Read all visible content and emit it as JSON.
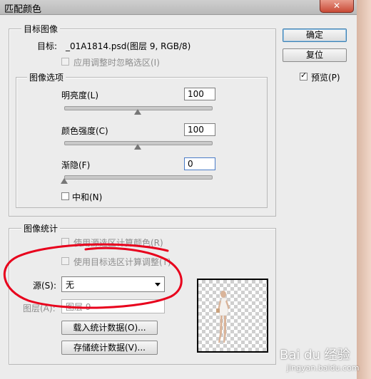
{
  "window": {
    "title": "匹配颜色",
    "close_symbol": "✕"
  },
  "target_image": {
    "group_label": "目标图像",
    "target_label": "目标:",
    "target_value": "_01A1814.psd(图层 9, RGB/8)",
    "ignore_selection_label": "应用调整时忽略选区(I)"
  },
  "image_options": {
    "group_label": "图像选项",
    "luminance_label": "明亮度(L)",
    "luminance_value": "100",
    "luminance_level": 0.5,
    "color_intensity_label": "颜色强度(C)",
    "color_intensity_value": "100",
    "color_intensity_level": 0.5,
    "fade_label": "渐隐(F)",
    "fade_value": "0",
    "fade_level": 0,
    "neutralize_label": "中和(N)"
  },
  "image_statistics": {
    "group_label": "图像统计",
    "use_source_selection_label": "使用源选区计算颜色(R)",
    "use_target_selection_label": "使用目标选区计算调整(T)",
    "source_label": "源(S):",
    "source_value": "无",
    "layer_label": "图层(A):",
    "layer_value": "图层 9",
    "load_stats_label": "载入统计数据(O)...",
    "save_stats_label": "存储统计数据(V)..."
  },
  "buttons": {
    "ok_label": "确定",
    "reset_label": "复位"
  },
  "preview": {
    "label": "预览(P)",
    "checked": true,
    "check_symbol": "✓"
  },
  "watermark": {
    "text": "Bai du 经验",
    "sub": "jingyan.baidu.com"
  },
  "colors": {
    "annotation_red": "#e8001c",
    "default_button_border": "#3c7fb1"
  }
}
